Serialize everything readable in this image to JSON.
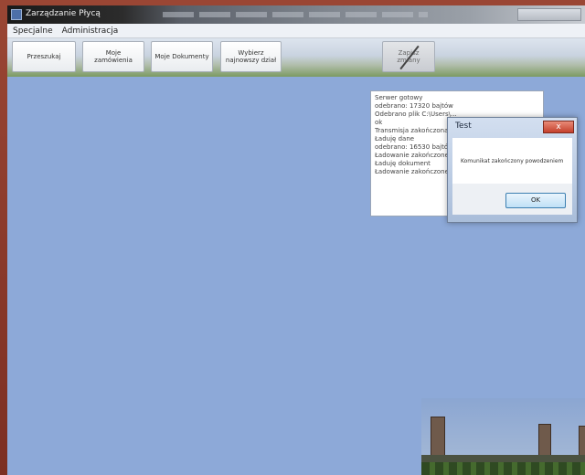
{
  "window": {
    "title": "Zarządzanie Płycą"
  },
  "menu": {
    "items": [
      "Specjalne",
      "Administracja"
    ]
  },
  "toolbar": {
    "buttons": [
      {
        "label": "Przeszukaj"
      },
      {
        "label": "Moje zamówienia"
      },
      {
        "label": "Moje Dokumenty"
      },
      {
        "label": "Wybierz najnowszy dział"
      },
      {
        "label": "Zapisz zmiany"
      }
    ]
  },
  "log": {
    "lines": [
      "Serwer gotowy",
      "odebrano: 17320 bajtów",
      "Odebrano plik C:\\Users\\...",
      "ok",
      "Transmisja zakończona",
      "Ładuję dane",
      "odebrano: 16530 bajtów",
      "Ładowanie zakończone",
      "Ładuję dokument",
      "Ładowanie zakończone"
    ]
  },
  "dialog": {
    "title": "Test",
    "close_glyph": "x",
    "message": "Komunikat zakończony powodzeniem",
    "ok_label": "OK"
  },
  "icons": {
    "app": "window-app-icon",
    "disabled_slash": "disabled-slash-icon"
  }
}
